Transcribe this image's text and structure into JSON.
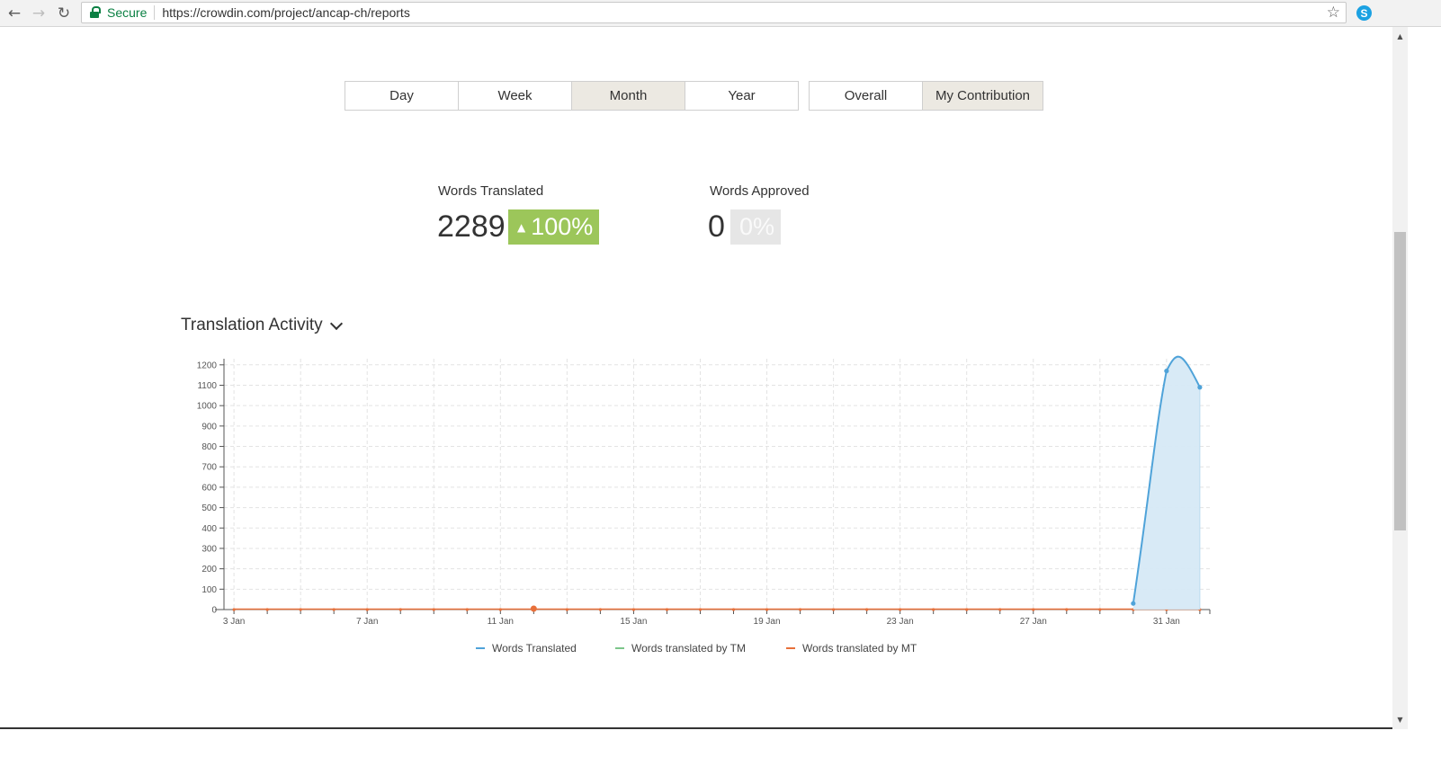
{
  "browser": {
    "secure_label": "Secure",
    "url": "https://crowdin.com/project/ancap-ch/reports"
  },
  "period_tabs": [
    {
      "label": "Day",
      "active": false
    },
    {
      "label": "Week",
      "active": false
    },
    {
      "label": "Month",
      "active": true
    },
    {
      "label": "Year",
      "active": false
    }
  ],
  "scope_tabs": [
    {
      "label": "Overall",
      "active": false
    },
    {
      "label": "My Contribution",
      "active": true
    }
  ],
  "stats": {
    "translated": {
      "label": "Words Translated",
      "value": "2289",
      "change": "100%"
    },
    "approved": {
      "label": "Words Approved",
      "value": "0",
      "change": "0%"
    }
  },
  "section": {
    "title": "Translation Activity"
  },
  "colors": {
    "translated": "#4fa3d9",
    "tm": "#7cc68a",
    "mt": "#e8703a",
    "badge_up": "#9cc65a"
  },
  "chart_data": {
    "type": "area",
    "ylim": [
      0,
      1200
    ],
    "yticks": [
      0,
      100,
      200,
      300,
      400,
      500,
      600,
      700,
      800,
      900,
      1000,
      1100,
      1200
    ],
    "x_days": [
      3,
      4,
      5,
      6,
      7,
      8,
      9,
      10,
      11,
      12,
      13,
      14,
      15,
      16,
      17,
      18,
      19,
      20,
      21,
      22,
      23,
      24,
      25,
      26,
      27,
      28,
      29,
      30,
      31,
      32
    ],
    "tick_labels": [
      {
        "day": 3,
        "label": "3 Jan"
      },
      {
        "day": 7,
        "label": "7 Jan"
      },
      {
        "day": 11,
        "label": "11 Jan"
      },
      {
        "day": 15,
        "label": "15 Jan"
      },
      {
        "day": 19,
        "label": "19 Jan"
      },
      {
        "day": 23,
        "label": "23 Jan"
      },
      {
        "day": 27,
        "label": "27 Jan"
      },
      {
        "day": 31,
        "label": "31 Jan"
      }
    ],
    "series": [
      {
        "name": "Words Translated",
        "points": [
          [
            30,
            30
          ],
          [
            31,
            1170
          ],
          [
            32,
            1090
          ]
        ]
      },
      {
        "name": "Words translated by TM",
        "points": []
      },
      {
        "name": "Words translated by MT",
        "points": [
          [
            12,
            0
          ]
        ]
      }
    ]
  }
}
